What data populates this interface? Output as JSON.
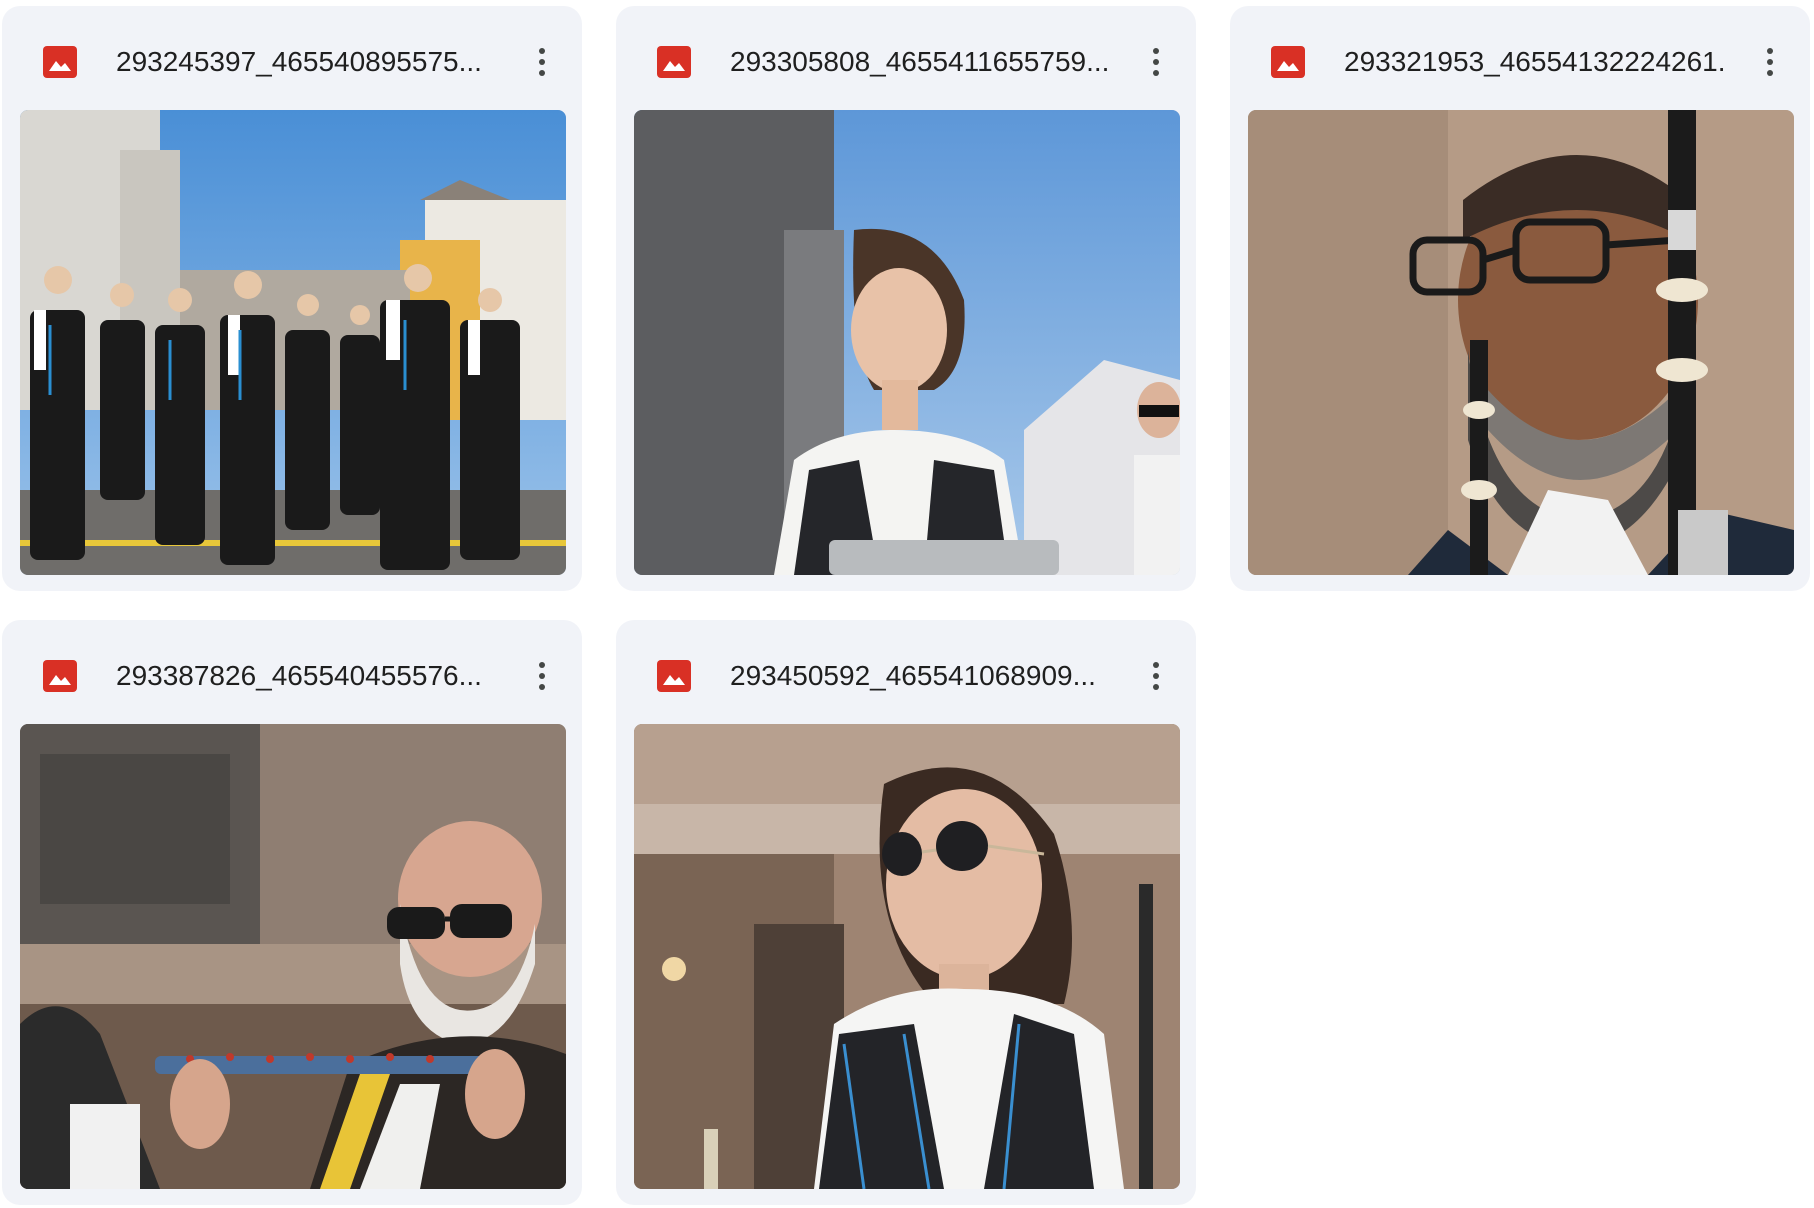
{
  "files": [
    {
      "name": "293245397_465540895575...",
      "icon": "image-icon",
      "thumbnail": "marching band parade with pipers and trumpeters"
    },
    {
      "name": "293305808_4655411655759...",
      "icon": "image-icon",
      "thumbnail": "short-haired woman musician in black vest"
    },
    {
      "name": "293321953_46554132224261...",
      "icon": "image-icon",
      "thumbnail": "bearded man with glasses playing bagpipe chanter"
    },
    {
      "name": "293387826_465540455576...",
      "icon": "image-icon",
      "thumbnail": "older man in sunglasses holding decorated instrument"
    },
    {
      "name": "293450592_465541068909...",
      "icon": "image-icon",
      "thumbnail": "woman in sunglasses in black embroidered vest"
    }
  ],
  "colors": {
    "card_background": "#f1f3f8",
    "image_icon": "#d93025",
    "text": "#1f1f1f",
    "more_icon": "#444746"
  }
}
